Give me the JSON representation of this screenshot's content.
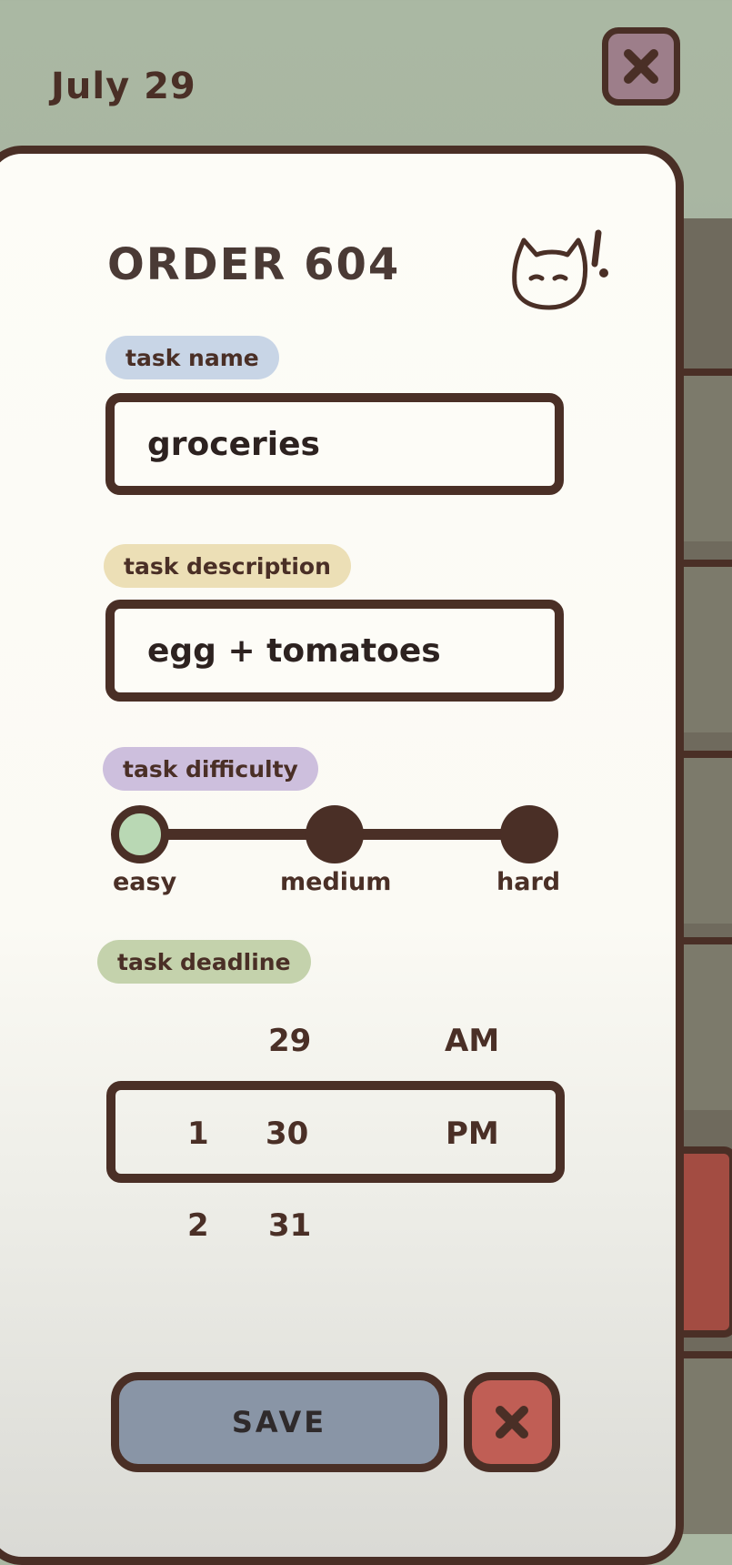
{
  "header": {
    "date": "July 29"
  },
  "order": {
    "title": "ORDER 604"
  },
  "fields": {
    "name_label": "task name",
    "name_value": "groceries",
    "description_label": "task description",
    "description_value": "egg + tomatoes",
    "difficulty_label": "task difficulty",
    "difficulty_options": [
      "easy",
      "medium",
      "hard"
    ],
    "difficulty_selected": "easy",
    "deadline_label": "task deadline"
  },
  "deadline_picker": {
    "above": {
      "day": "29",
      "ampm": "AM"
    },
    "selected": {
      "hour": "1",
      "day": "30",
      "ampm": "PM"
    },
    "below": {
      "hour": "2",
      "day": "31"
    }
  },
  "actions": {
    "save_label": "SAVE"
  },
  "colors": {
    "background": "#aab8a3",
    "outline": "#4a2f26",
    "card": "#fdfcf7",
    "pill_name": "#c8d5e6",
    "pill_description": "#ecdfb6",
    "pill_difficulty": "#cdbfdd",
    "pill_deadline": "#c4d2ac",
    "easy_dot": "#b9d8b4",
    "save_button": "#8995a6",
    "cancel_button": "#c05e55",
    "close_button": "#9d7e8a"
  },
  "icons": {
    "close": "close-icon",
    "cat": "cat-exclaim-icon",
    "cancel": "x-icon"
  }
}
